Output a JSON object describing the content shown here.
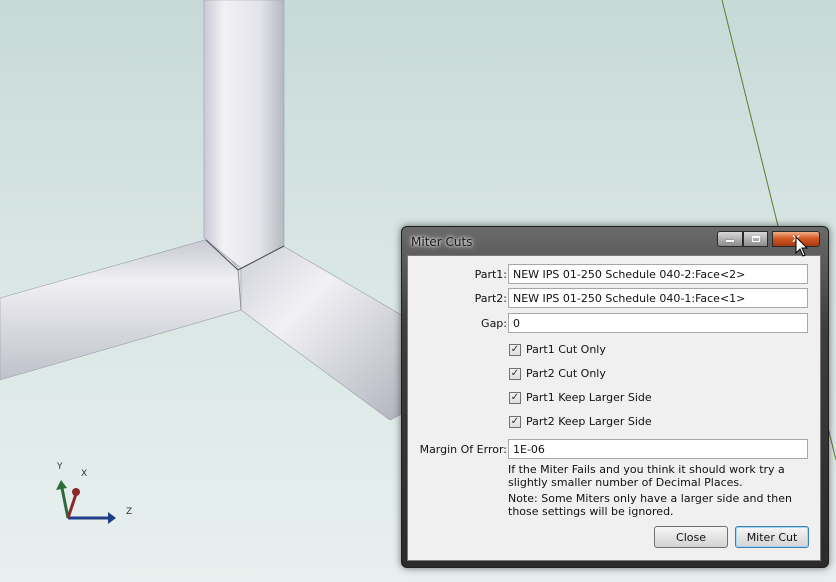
{
  "triad": {
    "y_label": "Y",
    "x_label": "X",
    "z_label": "Z"
  },
  "dialog": {
    "title": "Miter Cuts",
    "part1": {
      "label": "Part1:",
      "value": "NEW IPS 01-250 Schedule 040-2:Face<2>"
    },
    "part2": {
      "label": "Part2:",
      "value": "NEW IPS 01-250 Schedule 040-1:Face<1>"
    },
    "gap": {
      "label": "Gap:",
      "value": "0"
    },
    "checkboxes": [
      {
        "label": "Part1 Cut Only",
        "checked": true
      },
      {
        "label": "Part2 Cut Only",
        "checked": true
      },
      {
        "label": "Part1 Keep Larger Side",
        "checked": true
      },
      {
        "label": "Part2 Keep Larger Side",
        "checked": true
      }
    ],
    "margin": {
      "label": "Margin Of Error:",
      "value": "1E-06"
    },
    "note1": "If the Miter Fails and you think it should work try a slightly smaller number of Decimal Places.",
    "note2": "Note: Some Miters only have a larger side and then those settings will be ignored.",
    "close_label": "Close",
    "miter_label": "Miter Cut"
  },
  "colors": {
    "pipe": "#e9e9ee",
    "pipe_shadow": "#b9bbc4",
    "background_top": "#c7dad8",
    "line": "#5b7a2e"
  }
}
